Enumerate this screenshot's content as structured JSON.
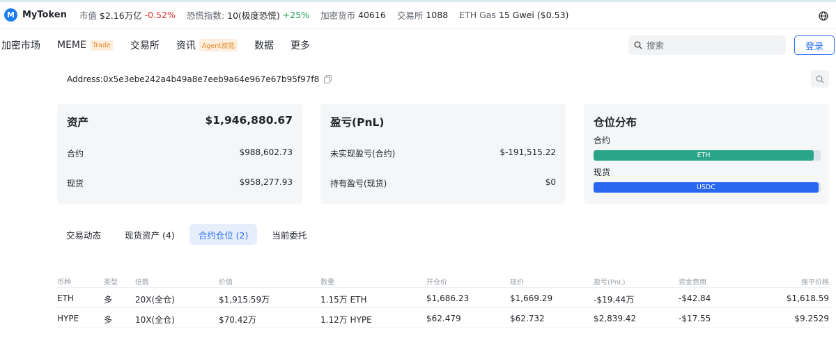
{
  "ticker": {
    "brand": "MyToken",
    "market_cap_label": "市值",
    "market_cap_value": "$2.16万亿",
    "market_cap_change": "-0.52%",
    "fear_label": "恐慌指数:",
    "fear_value": "10(极度恐慌)",
    "fear_change": "+25%",
    "crypto_label": "加密货币",
    "crypto_value": "40616",
    "exchange_label": "交易所",
    "exchange_value": "1088",
    "gas_label": "ETH Gas",
    "gas_value": "15 Gwei ($0.53)"
  },
  "nav": {
    "items": [
      {
        "label": "加密市场",
        "tag": ""
      },
      {
        "label": "MEME",
        "tag": "Trade"
      },
      {
        "label": "交易所",
        "tag": ""
      },
      {
        "label": "资讯",
        "tag": "Agent技能"
      },
      {
        "label": "数据",
        "tag": ""
      },
      {
        "label": "更多",
        "tag": ""
      }
    ],
    "search_placeholder": "搜索",
    "login_label": "登录"
  },
  "address": "Address:0x5e3ebe242a4b49a8e7eeb9a64e967e67b95f97f8",
  "assets": {
    "title": "资产",
    "total": "$1,946,880.67",
    "rows": [
      {
        "label": "合约",
        "value": "$988,602.73"
      },
      {
        "label": "现货",
        "value": "$958,277.93"
      }
    ]
  },
  "pnl": {
    "title": "盈亏(PnL)",
    "rows": [
      {
        "label": "未实现盈亏(合约)",
        "value": "$-191,515.22"
      },
      {
        "label": "持有盈亏(现货)",
        "value": "$0"
      }
    ]
  },
  "distribution": {
    "title": "仓位分布",
    "groups": [
      {
        "label": "合约",
        "bar_label": "ETH",
        "color": "#2aa58a",
        "fill_pct": 97
      },
      {
        "label": "现货",
        "bar_label": "USDC",
        "color": "#2a67f0",
        "fill_pct": 99
      }
    ]
  },
  "tabs": [
    {
      "label": "交易动态",
      "active": false
    },
    {
      "label": "现货资产 (4)",
      "active": false
    },
    {
      "label": "合约仓位 (2)",
      "active": true
    },
    {
      "label": "当前委托",
      "active": false
    }
  ],
  "table": {
    "headers": [
      "币种",
      "类型",
      "倍数",
      "价值",
      "数量",
      "开仓价",
      "现价",
      "盈亏(PnL)",
      "资金费用",
      "强平价格"
    ],
    "rows": [
      {
        "coin": "ETH",
        "type": "多",
        "leverage": "20X(全仓)",
        "value": "$1,915.59万",
        "qty": "1.15万 ETH",
        "open": "$1,686.23",
        "price": "$1,669.29",
        "pnl": "-$19.44万",
        "pnl_sign": "neg",
        "funding": "-$42.84",
        "liq": "$1,618.59"
      },
      {
        "coin": "HYPE",
        "type": "多",
        "leverage": "10X(全仓)",
        "value": "$70.42万",
        "qty": "1.12万 HYPE",
        "open": "$62.479",
        "price": "$62.732",
        "pnl": "$2,839.42",
        "pnl_sign": "pos",
        "funding": "-$17.55",
        "liq": "$9.2529"
      }
    ]
  },
  "colors": {
    "accent": "#2a6ff2",
    "up": "#1f9b55",
    "down": "#e0312d",
    "orange_tag": "#e38a2a"
  }
}
